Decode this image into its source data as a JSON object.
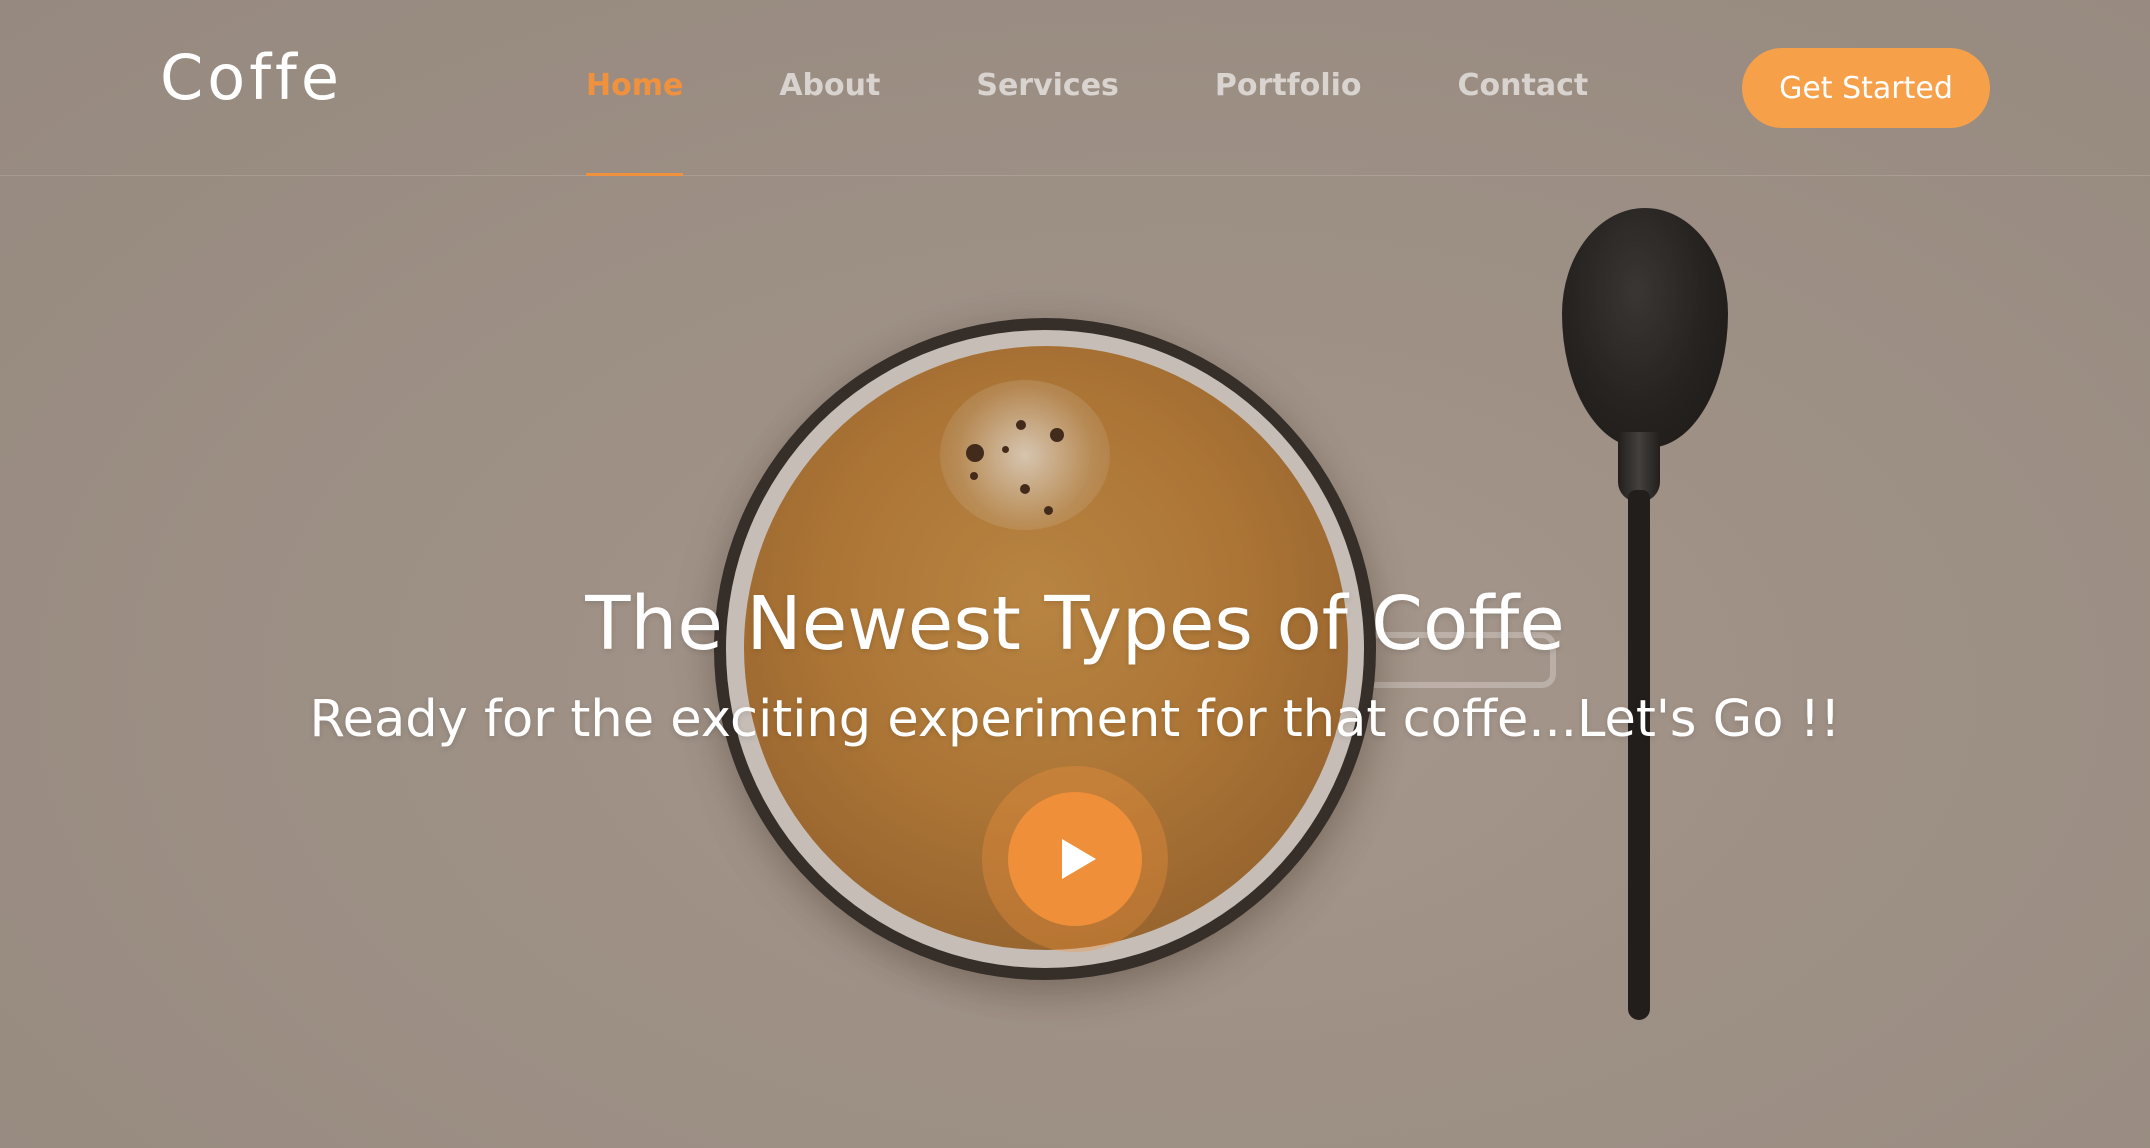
{
  "brand": {
    "name": "Coffe"
  },
  "nav": {
    "items": [
      {
        "label": "Home",
        "active": true
      },
      {
        "label": "About",
        "active": false
      },
      {
        "label": "Services",
        "active": false
      },
      {
        "label": "Portfolio",
        "active": false
      },
      {
        "label": "Contact",
        "active": false
      }
    ],
    "cta_label": "Get Started"
  },
  "hero": {
    "title": "The Newest Types of Coffe",
    "subtitle": "Ready for the exciting experiment for that coffe...Let's Go !!",
    "play_icon": "play-icon",
    "background_image": "coffee cup with spoon"
  },
  "colors": {
    "accent": "#f0923d",
    "cta": "#f6a04a",
    "text": "#ffffff",
    "nav_text": "#d8d2cc"
  }
}
